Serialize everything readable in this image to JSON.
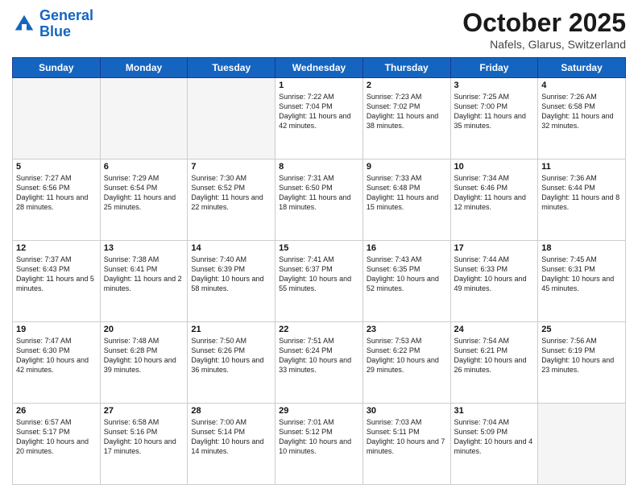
{
  "header": {
    "logo_line1": "General",
    "logo_line2": "Blue",
    "month": "October 2025",
    "location": "Nafels, Glarus, Switzerland"
  },
  "days_of_week": [
    "Sunday",
    "Monday",
    "Tuesday",
    "Wednesday",
    "Thursday",
    "Friday",
    "Saturday"
  ],
  "weeks": [
    [
      {
        "day": "",
        "text": ""
      },
      {
        "day": "",
        "text": ""
      },
      {
        "day": "",
        "text": ""
      },
      {
        "day": "1",
        "text": "Sunrise: 7:22 AM\nSunset: 7:04 PM\nDaylight: 11 hours\nand 42 minutes."
      },
      {
        "day": "2",
        "text": "Sunrise: 7:23 AM\nSunset: 7:02 PM\nDaylight: 11 hours\nand 38 minutes."
      },
      {
        "day": "3",
        "text": "Sunrise: 7:25 AM\nSunset: 7:00 PM\nDaylight: 11 hours\nand 35 minutes."
      },
      {
        "day": "4",
        "text": "Sunrise: 7:26 AM\nSunset: 6:58 PM\nDaylight: 11 hours\nand 32 minutes."
      }
    ],
    [
      {
        "day": "5",
        "text": "Sunrise: 7:27 AM\nSunset: 6:56 PM\nDaylight: 11 hours\nand 28 minutes."
      },
      {
        "day": "6",
        "text": "Sunrise: 7:29 AM\nSunset: 6:54 PM\nDaylight: 11 hours\nand 25 minutes."
      },
      {
        "day": "7",
        "text": "Sunrise: 7:30 AM\nSunset: 6:52 PM\nDaylight: 11 hours\nand 22 minutes."
      },
      {
        "day": "8",
        "text": "Sunrise: 7:31 AM\nSunset: 6:50 PM\nDaylight: 11 hours\nand 18 minutes."
      },
      {
        "day": "9",
        "text": "Sunrise: 7:33 AM\nSunset: 6:48 PM\nDaylight: 11 hours\nand 15 minutes."
      },
      {
        "day": "10",
        "text": "Sunrise: 7:34 AM\nSunset: 6:46 PM\nDaylight: 11 hours\nand 12 minutes."
      },
      {
        "day": "11",
        "text": "Sunrise: 7:36 AM\nSunset: 6:44 PM\nDaylight: 11 hours\nand 8 minutes."
      }
    ],
    [
      {
        "day": "12",
        "text": "Sunrise: 7:37 AM\nSunset: 6:43 PM\nDaylight: 11 hours\nand 5 minutes."
      },
      {
        "day": "13",
        "text": "Sunrise: 7:38 AM\nSunset: 6:41 PM\nDaylight: 11 hours\nand 2 minutes."
      },
      {
        "day": "14",
        "text": "Sunrise: 7:40 AM\nSunset: 6:39 PM\nDaylight: 10 hours\nand 58 minutes."
      },
      {
        "day": "15",
        "text": "Sunrise: 7:41 AM\nSunset: 6:37 PM\nDaylight: 10 hours\nand 55 minutes."
      },
      {
        "day": "16",
        "text": "Sunrise: 7:43 AM\nSunset: 6:35 PM\nDaylight: 10 hours\nand 52 minutes."
      },
      {
        "day": "17",
        "text": "Sunrise: 7:44 AM\nSunset: 6:33 PM\nDaylight: 10 hours\nand 49 minutes."
      },
      {
        "day": "18",
        "text": "Sunrise: 7:45 AM\nSunset: 6:31 PM\nDaylight: 10 hours\nand 45 minutes."
      }
    ],
    [
      {
        "day": "19",
        "text": "Sunrise: 7:47 AM\nSunset: 6:30 PM\nDaylight: 10 hours\nand 42 minutes."
      },
      {
        "day": "20",
        "text": "Sunrise: 7:48 AM\nSunset: 6:28 PM\nDaylight: 10 hours\nand 39 minutes."
      },
      {
        "day": "21",
        "text": "Sunrise: 7:50 AM\nSunset: 6:26 PM\nDaylight: 10 hours\nand 36 minutes."
      },
      {
        "day": "22",
        "text": "Sunrise: 7:51 AM\nSunset: 6:24 PM\nDaylight: 10 hours\nand 33 minutes."
      },
      {
        "day": "23",
        "text": "Sunrise: 7:53 AM\nSunset: 6:22 PM\nDaylight: 10 hours\nand 29 minutes."
      },
      {
        "day": "24",
        "text": "Sunrise: 7:54 AM\nSunset: 6:21 PM\nDaylight: 10 hours\nand 26 minutes."
      },
      {
        "day": "25",
        "text": "Sunrise: 7:56 AM\nSunset: 6:19 PM\nDaylight: 10 hours\nand 23 minutes."
      }
    ],
    [
      {
        "day": "26",
        "text": "Sunrise: 6:57 AM\nSunset: 5:17 PM\nDaylight: 10 hours\nand 20 minutes."
      },
      {
        "day": "27",
        "text": "Sunrise: 6:58 AM\nSunset: 5:16 PM\nDaylight: 10 hours\nand 17 minutes."
      },
      {
        "day": "28",
        "text": "Sunrise: 7:00 AM\nSunset: 5:14 PM\nDaylight: 10 hours\nand 14 minutes."
      },
      {
        "day": "29",
        "text": "Sunrise: 7:01 AM\nSunset: 5:12 PM\nDaylight: 10 hours\nand 10 minutes."
      },
      {
        "day": "30",
        "text": "Sunrise: 7:03 AM\nSunset: 5:11 PM\nDaylight: 10 hours\nand 7 minutes."
      },
      {
        "day": "31",
        "text": "Sunrise: 7:04 AM\nSunset: 5:09 PM\nDaylight: 10 hours\nand 4 minutes."
      },
      {
        "day": "",
        "text": ""
      }
    ]
  ]
}
